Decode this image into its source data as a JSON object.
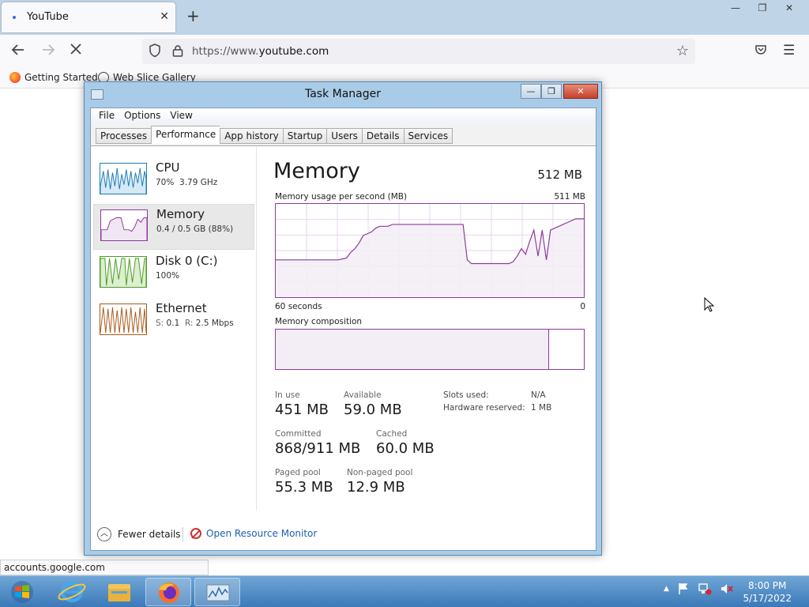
{
  "browser": {
    "tab_title": "YouTube",
    "tab_close": "✕",
    "new_tab": "+",
    "window_controls": [
      "—",
      "❐",
      "✕"
    ],
    "url_scheme": "https://www.",
    "url_host": "youtube.com",
    "bookmarks": [
      "Getting Started",
      "Web Slice Gallery"
    ],
    "status_url": "accounts.google.com"
  },
  "taskmanager": {
    "title": "Task Manager",
    "title_buttons": [
      "—",
      "❐",
      "✕"
    ],
    "menu": [
      "File",
      "Options",
      "View"
    ],
    "tabs": [
      "Processes",
      "Performance",
      "App history",
      "Startup",
      "Users",
      "Details",
      "Services"
    ],
    "active_tab": "Performance",
    "resources": [
      {
        "name": "CPU",
        "sub1": "70%",
        "sub2": "3.79 GHz",
        "color": "#1c7bb8"
      },
      {
        "name": "Memory",
        "sub1": "0.4 / 0.5 GB (88%)",
        "sub2": "",
        "color": "#8b3a9a"
      },
      {
        "name": "Disk 0 (C:)",
        "sub1": "100%",
        "sub2": "",
        "color": "#4d9a2a"
      },
      {
        "name": "Ethernet",
        "sub1": "S:",
        "sub1v": "0.1",
        "sub2": "R:",
        "sub2v": "2.5 Mbps",
        "color": "#a65a1c"
      }
    ],
    "memory": {
      "heading": "Memory",
      "total": "512 MB",
      "graph_label": "Memory usage per second (MB)",
      "graph_max": "511 MB",
      "graph_left": "60 seconds",
      "graph_right": "0",
      "composition_label": "Memory composition",
      "in_use_label": "In use",
      "in_use": "451 MB",
      "available_label": "Available",
      "available": "59.0 MB",
      "committed_label": "Committed",
      "committed": "868/911 MB",
      "cached_label": "Cached",
      "cached": "60.0 MB",
      "paged_label": "Paged pool",
      "paged": "55.3 MB",
      "nonpaged_label": "Non-paged pool",
      "nonpaged": "12.9 MB",
      "slots_label": "Slots used:",
      "slots": "N/A",
      "hwres_label": "Hardware reserved:",
      "hwres": "1 MB",
      "usage_series": [
        40,
        40,
        40,
        40,
        40,
        40,
        40,
        40,
        40,
        40,
        40,
        40,
        40,
        40,
        40,
        40,
        41,
        42,
        48,
        52,
        58,
        66,
        68,
        70,
        74,
        76,
        76,
        76,
        78,
        78,
        78,
        78,
        78,
        78,
        78,
        78,
        78,
        78,
        78,
        78,
        78,
        78,
        78,
        78,
        78,
        78,
        40,
        36,
        36,
        36,
        36,
        36,
        36,
        36,
        36,
        36,
        36,
        38,
        44,
        52,
        46,
        60,
        72,
        44,
        72,
        40,
        72,
        74,
        76,
        78,
        80,
        82,
        84,
        84,
        84
      ]
    },
    "footer": {
      "fewer": "Fewer details",
      "resource_monitor": "Open Resource Monitor"
    }
  },
  "taskbar": {
    "time": "8:00 PM",
    "date": "5/17/2022",
    "tray_arrow": "▲"
  }
}
